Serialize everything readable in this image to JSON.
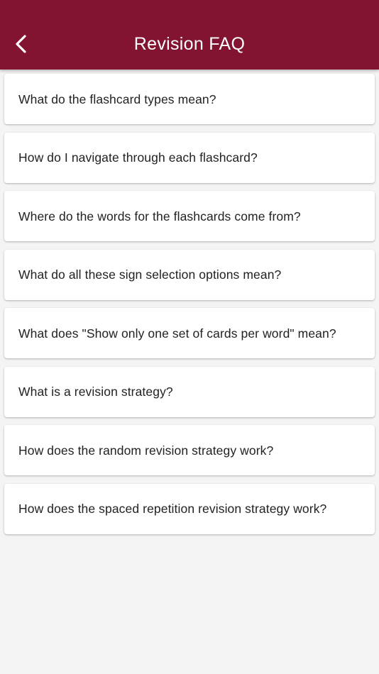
{
  "header": {
    "title": "Revision FAQ",
    "back_icon": "chevron-left-icon",
    "color": "#821331"
  },
  "faq": {
    "items": [
      {
        "label": "What do the flashcard types mean?"
      },
      {
        "label": "How do I navigate through each flashcard?"
      },
      {
        "label": "Where do the words for the flashcards come from?"
      },
      {
        "label": "What do all these sign selection options mean?"
      },
      {
        "label": "What does \"Show only one set of cards per word\" mean?"
      },
      {
        "label": "What is a revision strategy?"
      },
      {
        "label": "How does the random revision strategy work?"
      },
      {
        "label": "How does the spaced repetition revision strategy work?"
      }
    ]
  }
}
